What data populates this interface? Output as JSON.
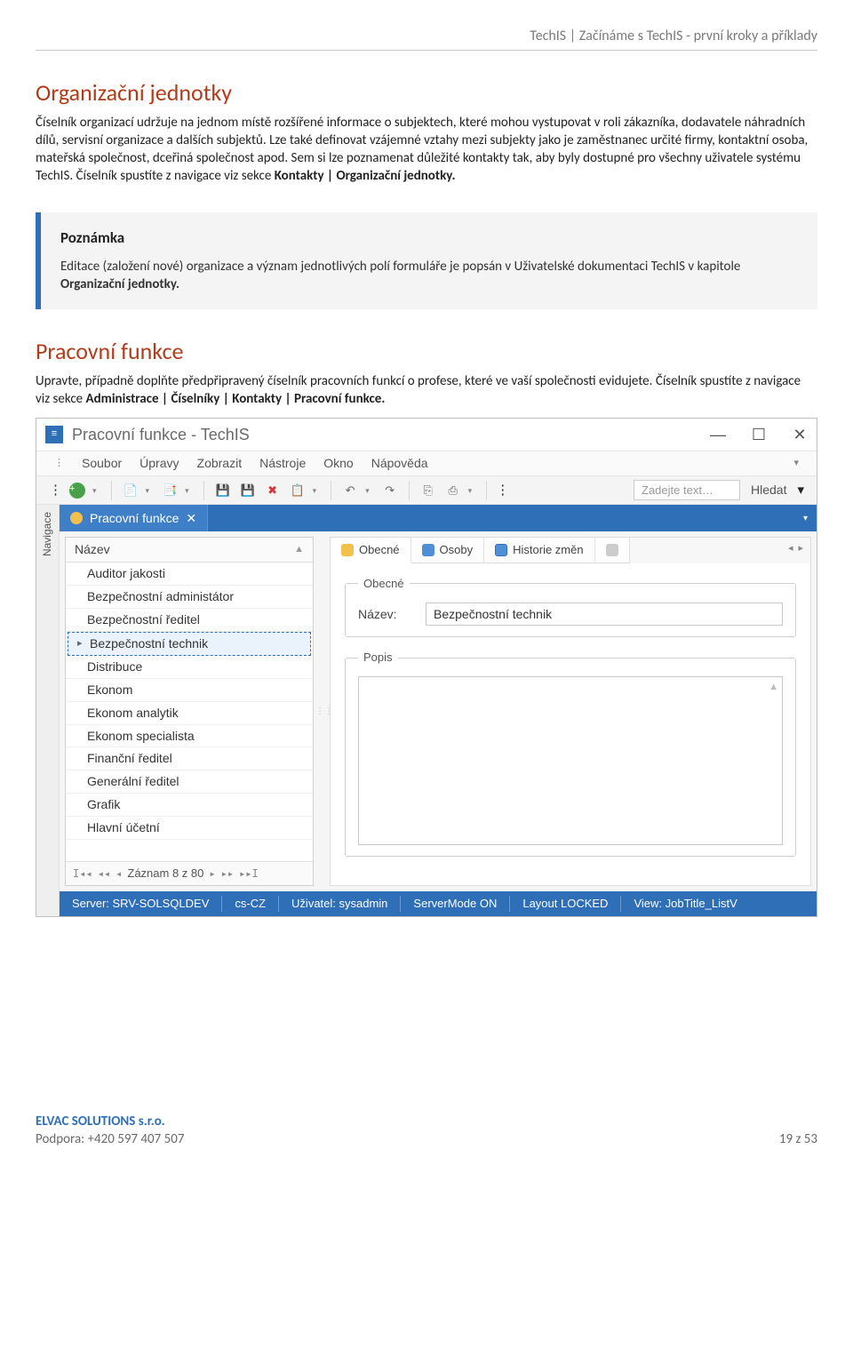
{
  "doc_header": "TechIS | Začínáme s TechIS - první kroky a příklady",
  "section1": {
    "heading": "Organizační jednotky",
    "body": "Číselník organizací udržuje na jednom místě rozšířené informace o subjektech, které mohou vystupovat v roli zákazníka, dodavatele náhradních dílů, servisní organizace a dalších subjektů. Lze také definovat vzájemné vztahy mezi subjekty jako je zaměstnanec určité firmy, kontaktní osoba, mateřská společnost, dceřiná společnost apod. Sem si lze poznamenat důležité kontakty tak, aby byly dostupné pro všechny uživatele systému TechIS. Číselník spustíte z navigace viz sekce ",
    "body_bold": "Kontakty | Organizační jednotky."
  },
  "note": {
    "heading": "Poznámka",
    "body_pre": "Editace (založení nové) organizace a význam jednotlivých polí formuláře je popsán v Uživatelské dokumentaci TechIS v kapitole ",
    "body_bold": "Organizační jednotky."
  },
  "section2": {
    "heading": "Pracovní funkce",
    "body_pre": "Upravte, případně doplňte předpřipravený číselník pracovních funkcí o profese, které ve vaší společnosti evidujete. Číselník spustíte z navigace viz sekce ",
    "body_bold": "Administrace | Číselníky | Kontakty | Pracovní funkce."
  },
  "app": {
    "title": "Pracovní funkce - TechIS",
    "menu": [
      "Soubor",
      "Úpravy",
      "Zobrazit",
      "Nástroje",
      "Okno",
      "Nápověda"
    ],
    "search_placeholder": "Zadejte text…",
    "search_button": "Hledat",
    "nav_sidebar": "Navigace",
    "doc_tab": "Pracovní funkce",
    "grid_header": "Název",
    "grid_rows": [
      "Auditor jakosti",
      "Bezpečnostní administátor",
      "Bezpečnostní ředitel",
      "Bezpečnostní technik",
      "Distribuce",
      "Ekonom",
      "Ekonom analytik",
      "Ekonom specialista",
      "Finanční ředitel",
      "Generální ředitel",
      "Grafik",
      "Hlavní účetní"
    ],
    "selected_index": 3,
    "pager": "Záznam 8 z 80",
    "detail_tabs": {
      "obecne": "Obecné",
      "osoby": "Osoby",
      "historie": "Historie změn"
    },
    "group_obecne": "Obecné",
    "field_nazev_label": "Název:",
    "field_nazev_value": "Bezpečnostní technik",
    "group_popis": "Popis",
    "status": {
      "server": "Server: SRV-SOLSQLDEV",
      "culture": "cs-CZ",
      "user": "Uživatel: sysadmin",
      "servermode": "ServerMode ON",
      "layout": "Layout LOCKED",
      "view": "View: JobTitle_ListV"
    }
  },
  "footer": {
    "company": "ELVAC SOLUTIONS s.r.o.",
    "support": "Podpora: +420 597 407 507",
    "page": "19 z 53"
  }
}
